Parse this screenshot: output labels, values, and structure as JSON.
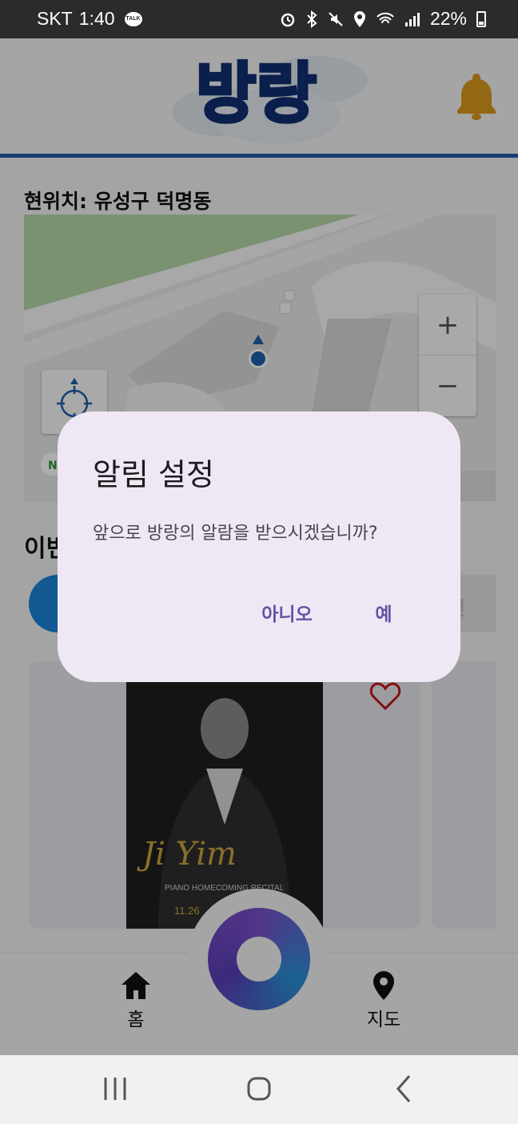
{
  "status_bar": {
    "carrier": "SKT",
    "time": "1:40",
    "talk_badge": "TALK",
    "battery": "22%"
  },
  "header": {
    "logo_text": "방랑"
  },
  "location": {
    "label": "현위치: 유성구 덕명동"
  },
  "map": {
    "zoom_in_label": "+",
    "zoom_out_label": "−"
  },
  "section": {
    "title": "이번",
    "chip_right_text": "전"
  },
  "event_card": {
    "poster_signature": "Ji Yim",
    "poster_subtitle": "PIANO HOMECOMING RECITAL",
    "poster_date": "11.26"
  },
  "bottom_nav": {
    "home_label": "홈",
    "map_label": "지도"
  },
  "dialog": {
    "title": "알림 설정",
    "message": "앞으로 방랑의 알람을 받으시겠습니까?",
    "no_label": "아니오",
    "yes_label": "예"
  },
  "colors": {
    "accent": "#6750a4",
    "header_line": "#1f5faa",
    "bell": "#d99a1e",
    "chip_blue": "#1a84d4"
  }
}
